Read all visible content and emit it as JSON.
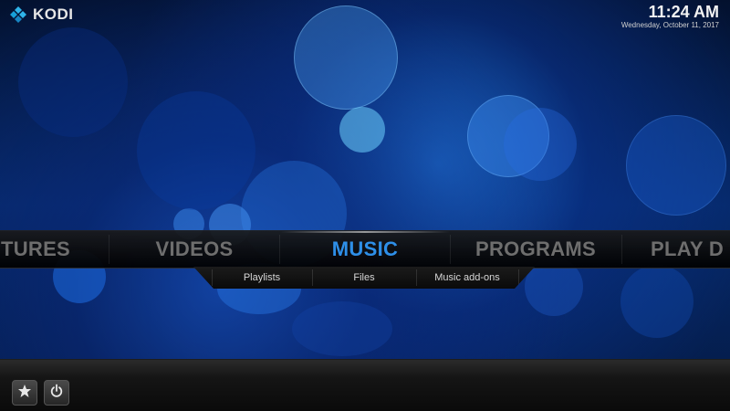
{
  "app": {
    "name": "KODI",
    "logo_icon": "kodi-logo-icon"
  },
  "clock": {
    "time": "11:24 AM",
    "date": "Wednesday, October 11, 2017"
  },
  "main_menu": {
    "items": [
      {
        "label": "TURES",
        "active": false
      },
      {
        "label": "VIDEOS",
        "active": false
      },
      {
        "label": "MUSIC",
        "active": true
      },
      {
        "label": "PROGRAMS",
        "active": false
      },
      {
        "label": "PLAY D",
        "active": false
      }
    ],
    "active_color": "#2e8fe8",
    "inactive_color": "#6e6e6e"
  },
  "submenu": {
    "items": [
      {
        "label": "Playlists"
      },
      {
        "label": "Files"
      },
      {
        "label": "Music add-ons"
      }
    ]
  },
  "bottom_bar": {
    "buttons": [
      {
        "name": "favourites",
        "icon": "star-icon"
      },
      {
        "name": "power",
        "icon": "power-icon"
      }
    ]
  }
}
